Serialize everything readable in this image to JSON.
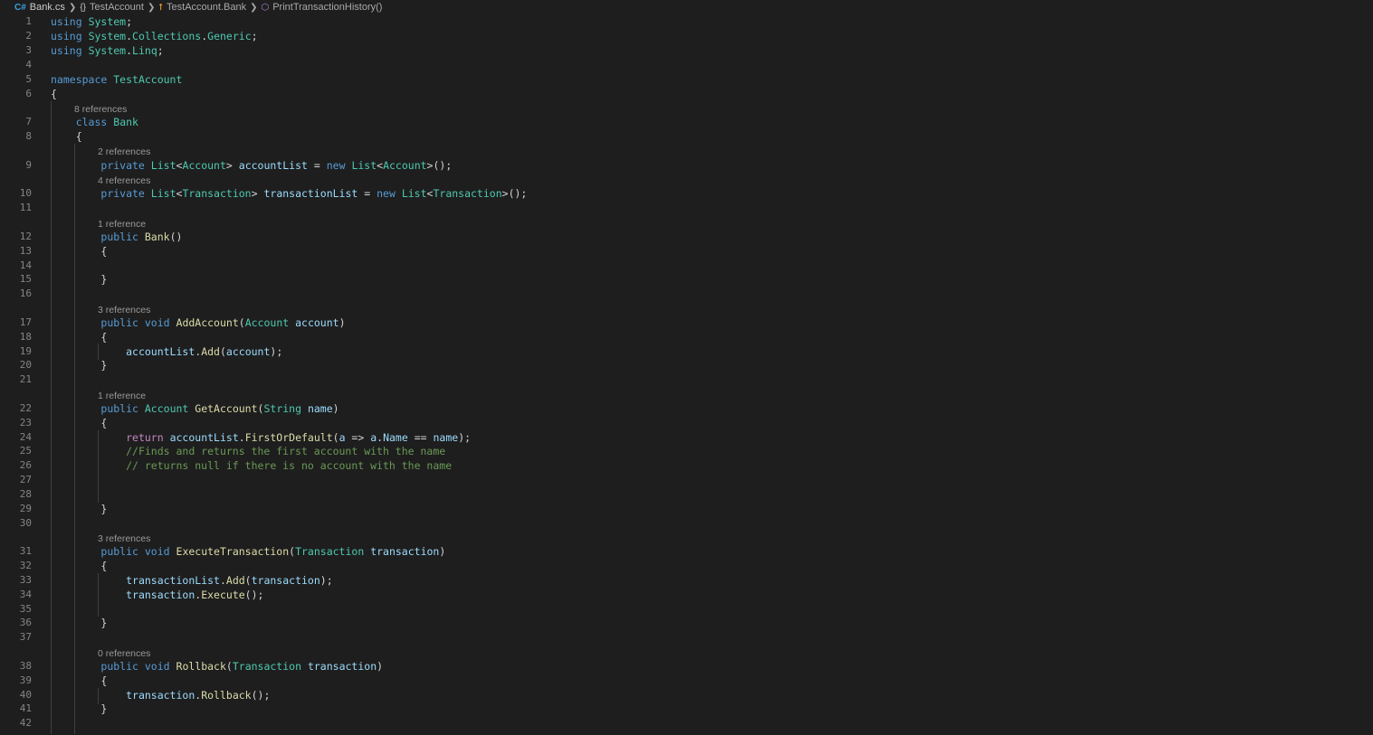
{
  "breadcrumb": {
    "file": "Bank.cs",
    "namespace": "TestAccount",
    "class": "TestAccount.Bank",
    "method": "PrintTransactionHistory()",
    "file_icon": "csharp-file-icon",
    "namespace_icon": "braces-namespace-icon",
    "class_icon": "class-icon",
    "method_icon": "method-cube-icon"
  },
  "colors": {
    "background": "#1e1e1e",
    "keyword": "#569cd6",
    "control_keyword": "#c586c0",
    "type": "#4ec9b0",
    "function": "#dcdcaa",
    "variable": "#9cdcfe",
    "comment": "#6a9955",
    "line_number": "#858585",
    "codelens": "#999999"
  },
  "code_lens": {
    "class_bank": "8 references",
    "account_list": "2 references",
    "transaction_list": "4 references",
    "ctor_bank": "1 reference",
    "add_account": "3 references",
    "get_account": "1 reference",
    "execute_transaction": "3 references",
    "rollback": "0 references"
  },
  "lines": [
    {
      "n": "1",
      "tokens": [
        [
          "kw",
          "using"
        ],
        [
          "pl",
          " "
        ],
        [
          "ty",
          "System"
        ],
        [
          "pl",
          ";"
        ]
      ]
    },
    {
      "n": "2",
      "tokens": [
        [
          "kw",
          "using"
        ],
        [
          "pl",
          " "
        ],
        [
          "ty",
          "System"
        ],
        [
          "pl",
          "."
        ],
        [
          "ty",
          "Collections"
        ],
        [
          "pl",
          "."
        ],
        [
          "ty",
          "Generic"
        ],
        [
          "pl",
          ";"
        ]
      ]
    },
    {
      "n": "3",
      "tokens": [
        [
          "kw",
          "using"
        ],
        [
          "pl",
          " "
        ],
        [
          "ty",
          "System"
        ],
        [
          "pl",
          "."
        ],
        [
          "ty",
          "Linq"
        ],
        [
          "pl",
          ";"
        ]
      ]
    },
    {
      "n": "4",
      "tokens": []
    },
    {
      "n": "5",
      "tokens": [
        [
          "kw",
          "namespace"
        ],
        [
          "pl",
          " "
        ],
        [
          "ty",
          "TestAccount"
        ]
      ]
    },
    {
      "n": "6",
      "tokens": [
        [
          "pl",
          "{"
        ]
      ]
    },
    {
      "n": "7",
      "tokens": [
        [
          "pl",
          "    "
        ],
        [
          "kw",
          "class"
        ],
        [
          "pl",
          " "
        ],
        [
          "ty",
          "Bank"
        ]
      ]
    },
    {
      "n": "8",
      "tokens": [
        [
          "pl",
          "    {"
        ]
      ]
    },
    {
      "n": "9",
      "tokens": [
        [
          "pl",
          "        "
        ],
        [
          "kw",
          "private"
        ],
        [
          "pl",
          " "
        ],
        [
          "ty",
          "List"
        ],
        [
          "pl",
          "<"
        ],
        [
          "ty",
          "Account"
        ],
        [
          "pl",
          "> "
        ],
        [
          "vr",
          "accountList"
        ],
        [
          "pl",
          " = "
        ],
        [
          "kw",
          "new"
        ],
        [
          "pl",
          " "
        ],
        [
          "ty",
          "List"
        ],
        [
          "pl",
          "<"
        ],
        [
          "ty",
          "Account"
        ],
        [
          "pl",
          ">();"
        ]
      ]
    },
    {
      "n": "10",
      "tokens": [
        [
          "pl",
          "        "
        ],
        [
          "kw",
          "private"
        ],
        [
          "pl",
          " "
        ],
        [
          "ty",
          "List"
        ],
        [
          "pl",
          "<"
        ],
        [
          "ty",
          "Transaction"
        ],
        [
          "pl",
          "> "
        ],
        [
          "vr",
          "transactionList"
        ],
        [
          "pl",
          " = "
        ],
        [
          "kw",
          "new"
        ],
        [
          "pl",
          " "
        ],
        [
          "ty",
          "List"
        ],
        [
          "pl",
          "<"
        ],
        [
          "ty",
          "Transaction"
        ],
        [
          "pl",
          ">();"
        ]
      ]
    },
    {
      "n": "11",
      "tokens": []
    },
    {
      "n": "12",
      "tokens": [
        [
          "pl",
          "        "
        ],
        [
          "kw",
          "public"
        ],
        [
          "pl",
          " "
        ],
        [
          "fn",
          "Bank"
        ],
        [
          "pl",
          "()"
        ]
      ]
    },
    {
      "n": "13",
      "tokens": [
        [
          "pl",
          "        {"
        ]
      ]
    },
    {
      "n": "14",
      "tokens": []
    },
    {
      "n": "15",
      "tokens": [
        [
          "pl",
          "        }"
        ]
      ]
    },
    {
      "n": "16",
      "tokens": []
    },
    {
      "n": "17",
      "tokens": [
        [
          "pl",
          "        "
        ],
        [
          "kw",
          "public"
        ],
        [
          "pl",
          " "
        ],
        [
          "kw",
          "void"
        ],
        [
          "pl",
          " "
        ],
        [
          "fn",
          "AddAccount"
        ],
        [
          "pl",
          "("
        ],
        [
          "ty",
          "Account"
        ],
        [
          "pl",
          " "
        ],
        [
          "vr",
          "account"
        ],
        [
          "pl",
          ")"
        ]
      ]
    },
    {
      "n": "18",
      "tokens": [
        [
          "pl",
          "        {"
        ]
      ]
    },
    {
      "n": "19",
      "tokens": [
        [
          "pl",
          "            "
        ],
        [
          "vr",
          "accountList"
        ],
        [
          "pl",
          "."
        ],
        [
          "fn",
          "Add"
        ],
        [
          "pl",
          "("
        ],
        [
          "vr",
          "account"
        ],
        [
          "pl",
          ");"
        ]
      ]
    },
    {
      "n": "20",
      "tokens": [
        [
          "pl",
          "        }"
        ]
      ]
    },
    {
      "n": "21",
      "tokens": []
    },
    {
      "n": "22",
      "tokens": [
        [
          "pl",
          "        "
        ],
        [
          "kw",
          "public"
        ],
        [
          "pl",
          " "
        ],
        [
          "ty",
          "Account"
        ],
        [
          "pl",
          " "
        ],
        [
          "fn",
          "GetAccount"
        ],
        [
          "pl",
          "("
        ],
        [
          "ty",
          "String"
        ],
        [
          "pl",
          " "
        ],
        [
          "vr",
          "name"
        ],
        [
          "pl",
          ")"
        ]
      ]
    },
    {
      "n": "23",
      "tokens": [
        [
          "pl",
          "        {"
        ]
      ]
    },
    {
      "n": "24",
      "tokens": [
        [
          "pl",
          "            "
        ],
        [
          "ctl",
          "return"
        ],
        [
          "pl",
          " "
        ],
        [
          "vr",
          "accountList"
        ],
        [
          "pl",
          "."
        ],
        [
          "fn",
          "FirstOrDefault"
        ],
        [
          "pl",
          "("
        ],
        [
          "vr",
          "a"
        ],
        [
          "pl",
          " => "
        ],
        [
          "vr",
          "a"
        ],
        [
          "pl",
          "."
        ],
        [
          "vr",
          "Name"
        ],
        [
          "pl",
          " == "
        ],
        [
          "vr",
          "name"
        ],
        [
          "pl",
          ");"
        ]
      ]
    },
    {
      "n": "25",
      "tokens": [
        [
          "pl",
          "            "
        ],
        [
          "cm",
          "//Finds and returns the first account with the name"
        ]
      ]
    },
    {
      "n": "26",
      "tokens": [
        [
          "pl",
          "            "
        ],
        [
          "cm",
          "// returns null if there is no account with the name"
        ]
      ]
    },
    {
      "n": "27",
      "tokens": []
    },
    {
      "n": "28",
      "tokens": []
    },
    {
      "n": "29",
      "tokens": [
        [
          "pl",
          "        }"
        ]
      ]
    },
    {
      "n": "30",
      "tokens": []
    },
    {
      "n": "31",
      "tokens": [
        [
          "pl",
          "        "
        ],
        [
          "kw",
          "public"
        ],
        [
          "pl",
          " "
        ],
        [
          "kw",
          "void"
        ],
        [
          "pl",
          " "
        ],
        [
          "fn",
          "ExecuteTransaction"
        ],
        [
          "pl",
          "("
        ],
        [
          "ty",
          "Transaction"
        ],
        [
          "pl",
          " "
        ],
        [
          "vr",
          "transaction"
        ],
        [
          "pl",
          ")"
        ]
      ]
    },
    {
      "n": "32",
      "tokens": [
        [
          "pl",
          "        {"
        ]
      ]
    },
    {
      "n": "33",
      "tokens": [
        [
          "pl",
          "            "
        ],
        [
          "vr",
          "transactionList"
        ],
        [
          "pl",
          "."
        ],
        [
          "fn",
          "Add"
        ],
        [
          "pl",
          "("
        ],
        [
          "vr",
          "transaction"
        ],
        [
          "pl",
          ");"
        ]
      ]
    },
    {
      "n": "34",
      "tokens": [
        [
          "pl",
          "            "
        ],
        [
          "vr",
          "transaction"
        ],
        [
          "pl",
          "."
        ],
        [
          "fn",
          "Execute"
        ],
        [
          "pl",
          "();"
        ]
      ]
    },
    {
      "n": "35",
      "tokens": []
    },
    {
      "n": "36",
      "tokens": [
        [
          "pl",
          "        }"
        ]
      ]
    },
    {
      "n": "37",
      "tokens": []
    },
    {
      "n": "38",
      "tokens": [
        [
          "pl",
          "        "
        ],
        [
          "kw",
          "public"
        ],
        [
          "pl",
          " "
        ],
        [
          "kw",
          "void"
        ],
        [
          "pl",
          " "
        ],
        [
          "fn",
          "Rollback"
        ],
        [
          "pl",
          "("
        ],
        [
          "ty",
          "Transaction"
        ],
        [
          "pl",
          " "
        ],
        [
          "vr",
          "transaction"
        ],
        [
          "pl",
          ")"
        ]
      ]
    },
    {
      "n": "39",
      "tokens": [
        [
          "pl",
          "        {"
        ]
      ]
    },
    {
      "n": "40",
      "tokens": [
        [
          "pl",
          "            "
        ],
        [
          "vr",
          "transaction"
        ],
        [
          "pl",
          "."
        ],
        [
          "fn",
          "Rollback"
        ],
        [
          "pl",
          "();"
        ]
      ]
    },
    {
      "n": "41",
      "tokens": [
        [
          "pl",
          "        }"
        ]
      ]
    },
    {
      "n": "42",
      "tokens": []
    }
  ]
}
